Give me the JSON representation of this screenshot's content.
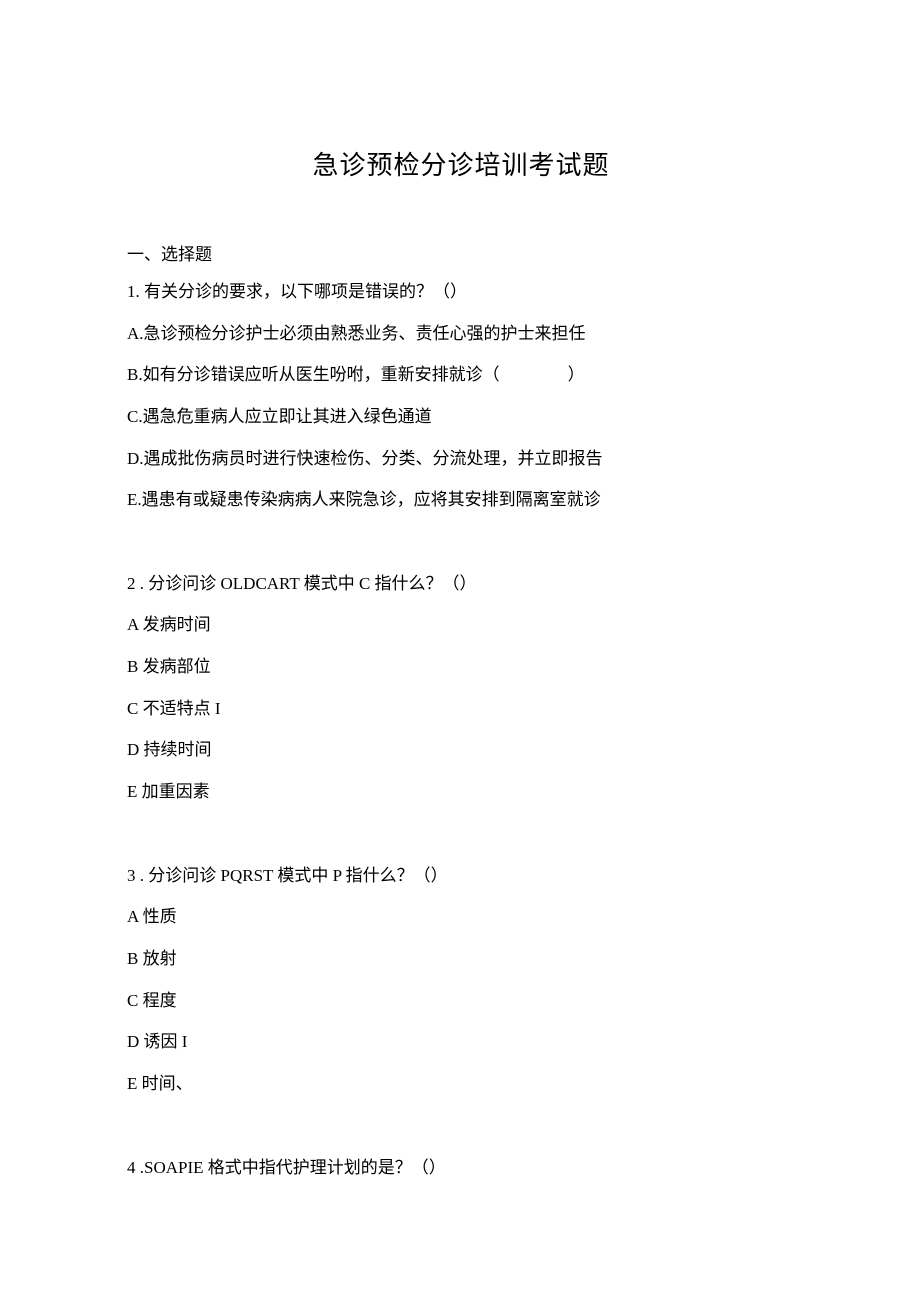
{
  "title": "急诊预检分诊培训考试题",
  "section_header": "一、选择题",
  "q1": {
    "stem": "1. 有关分诊的要求，以下哪项是错误的？（）",
    "A": "A.急诊预检分诊护士必须由熟悉业务、责任心强的护士来担任",
    "B": "B.如有分诊错误应听从医生吩咐，重新安排就诊（    ）",
    "C": "C.遇急危重病人应立即让其进入绿色通道",
    "D": "D.遇成批伤病员时进行快速检伤、分类、分流处理，并立即报告",
    "E": "E.遇患有或疑患传染病病人来院急诊，应将其安排到隔离室就诊"
  },
  "q2": {
    "stem": "2 . 分诊问诊 OLDCART 模式中 C 指什么？（）",
    "A": "A 发病时间",
    "B": "B 发病部位",
    "C": "C 不适特点 I",
    "D": "D 持续时间",
    "E": "E 加重因素"
  },
  "q3": {
    "stem": "3 . 分诊问诊 PQRST 模式中 P 指什么？（）",
    "A": "A 性质",
    "B": "B 放射",
    "C": "C 程度",
    "D": "D 诱因 I",
    "E": "E 时间、"
  },
  "q4": {
    "stem": "4 .SOAPIE 格式中指代护理计划的是？（）"
  }
}
